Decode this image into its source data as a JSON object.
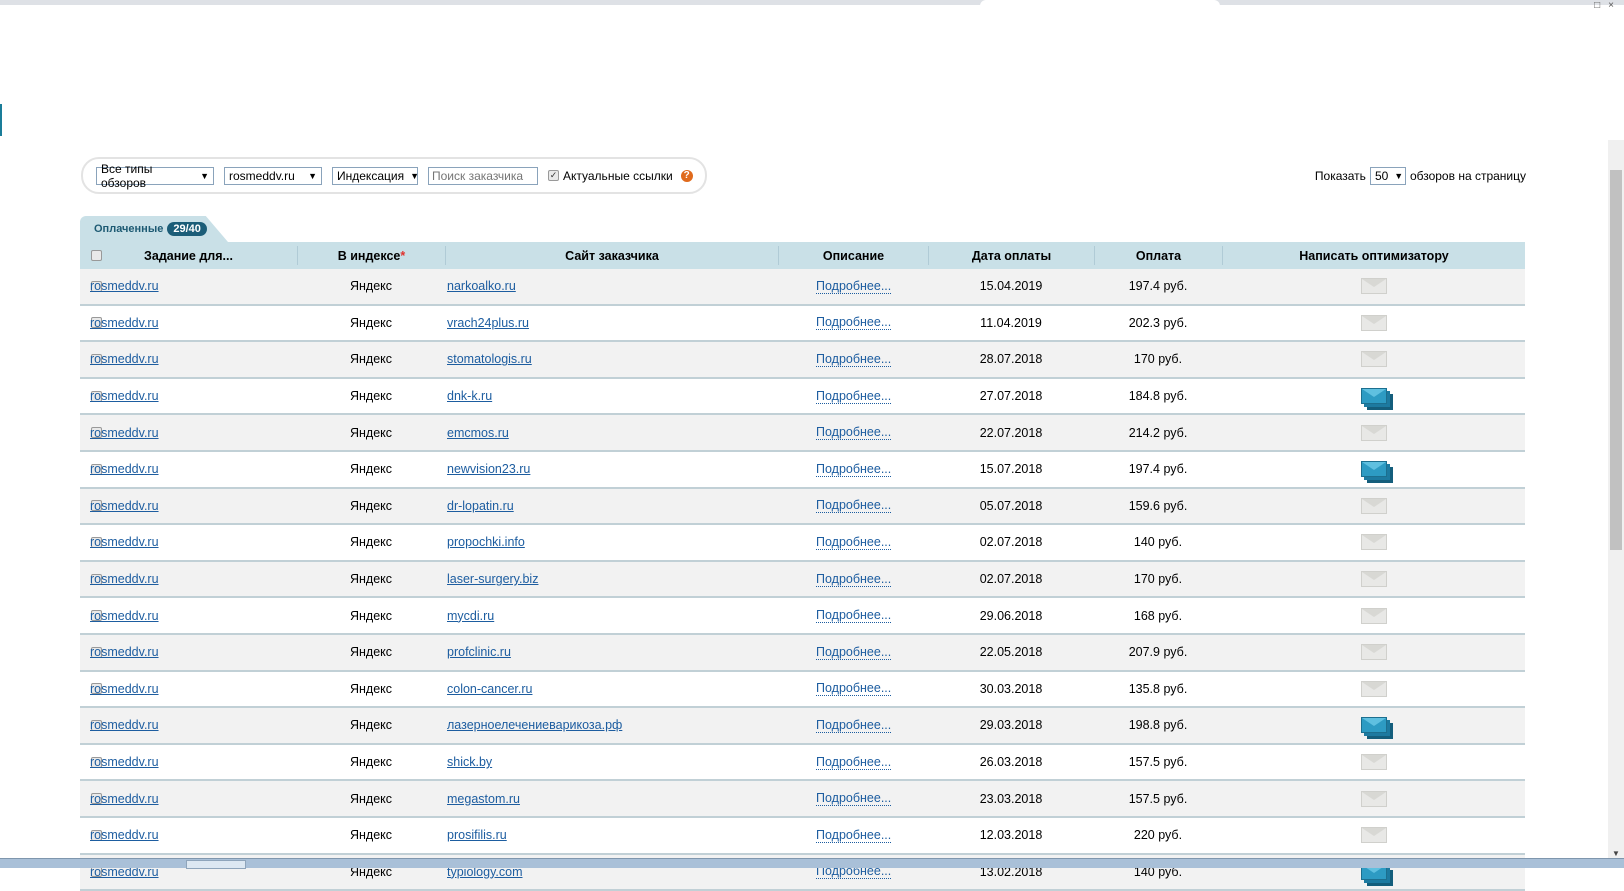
{
  "filters": {
    "review_type": "Все типы обзоров",
    "site": "rosmeddv.ru",
    "indexing": "Индексация",
    "search_placeholder": "Поиск заказчика",
    "actual_links_label": "Актуальные ссылки",
    "actual_links_checked": true,
    "help": "?"
  },
  "per_page": {
    "prefix": "Показать",
    "value": "50",
    "suffix": "обзоров на страницу"
  },
  "tab": {
    "label": "Оплаченные",
    "badge": "29/40"
  },
  "columns": [
    "Задание для...",
    "В индексе",
    "Сайт заказчика",
    "Описание",
    "Дата оплаты",
    "Оплата",
    "Написать оптимизатору"
  ],
  "index_star": "*",
  "rows": [
    {
      "task": "rosmeddv.ru",
      "index": "Яндекс",
      "site": "narkoalko.ru",
      "desc": "Подробнее...",
      "date": "15.04.2019",
      "pay": "197.4 руб.",
      "msg": "grey"
    },
    {
      "task": "rosmeddv.ru",
      "index": "Яндекс",
      "site": "vrach24plus.ru",
      "desc": "Подробнее...",
      "date": "11.04.2019",
      "pay": "202.3 руб.",
      "msg": "grey"
    },
    {
      "task": "rosmeddv.ru",
      "index": "Яндекс",
      "site": "stomatologis.ru",
      "desc": "Подробнее...",
      "date": "28.07.2018",
      "pay": "170 руб.",
      "msg": "grey"
    },
    {
      "task": "rosmeddv.ru",
      "index": "Яндекс",
      "site": "dnk-k.ru",
      "desc": "Подробнее...",
      "date": "27.07.2018",
      "pay": "184.8 руб.",
      "msg": "blue"
    },
    {
      "task": "rosmeddv.ru",
      "index": "Яндекс",
      "site": "emcmos.ru",
      "desc": "Подробнее...",
      "date": "22.07.2018",
      "pay": "214.2 руб.",
      "msg": "grey"
    },
    {
      "task": "rosmeddv.ru",
      "index": "Яндекс",
      "site": "newvision23.ru",
      "desc": "Подробнее...",
      "date": "15.07.2018",
      "pay": "197.4 руб.",
      "msg": "blue"
    },
    {
      "task": "rosmeddv.ru",
      "index": "Яндекс",
      "site": "dr-lopatin.ru",
      "desc": "Подробнее...",
      "date": "05.07.2018",
      "pay": "159.6 руб.",
      "msg": "grey"
    },
    {
      "task": "rosmeddv.ru",
      "index": "Яндекс",
      "site": "propochki.info",
      "desc": "Подробнее...",
      "date": "02.07.2018",
      "pay": "140 руб.",
      "msg": "grey"
    },
    {
      "task": "rosmeddv.ru",
      "index": "Яндекс",
      "site": "laser-surgery.biz",
      "desc": "Подробнее...",
      "date": "02.07.2018",
      "pay": "170 руб.",
      "msg": "grey"
    },
    {
      "task": "rosmeddv.ru",
      "index": "Яндекс",
      "site": "mycdi.ru",
      "desc": "Подробнее...",
      "date": "29.06.2018",
      "pay": "168 руб.",
      "msg": "grey"
    },
    {
      "task": "rosmeddv.ru",
      "index": "Яндекс",
      "site": "profclinic.ru",
      "desc": "Подробнее...",
      "date": "22.05.2018",
      "pay": "207.9 руб.",
      "msg": "grey"
    },
    {
      "task": "rosmeddv.ru",
      "index": "Яндекс",
      "site": "colon-cancer.ru",
      "desc": "Подробнее...",
      "date": "30.03.2018",
      "pay": "135.8 руб.",
      "msg": "grey"
    },
    {
      "task": "rosmeddv.ru",
      "index": "Яндекс",
      "site": "лазерноелечениеварикоза.рф",
      "desc": "Подробнее...",
      "date": "29.03.2018",
      "pay": "198.8 руб.",
      "msg": "blue"
    },
    {
      "task": "rosmeddv.ru",
      "index": "Яндекс",
      "site": "shick.by",
      "desc": "Подробнее...",
      "date": "26.03.2018",
      "pay": "157.5 руб.",
      "msg": "grey"
    },
    {
      "task": "rosmeddv.ru",
      "index": "Яндекс",
      "site": "megastom.ru",
      "desc": "Подробнее...",
      "date": "23.03.2018",
      "pay": "157.5 руб.",
      "msg": "grey"
    },
    {
      "task": "rosmeddv.ru",
      "index": "Яндекс",
      "site": "prosifilis.ru",
      "desc": "Подробнее...",
      "date": "12.03.2018",
      "pay": "220 руб.",
      "msg": "grey"
    },
    {
      "task": "rosmeddv.ru",
      "index": "Яндекс",
      "site": "typiology.com",
      "desc": "Подробнее...",
      "date": "13.02.2018",
      "pay": "140 руб.",
      "msg": "blue"
    }
  ]
}
